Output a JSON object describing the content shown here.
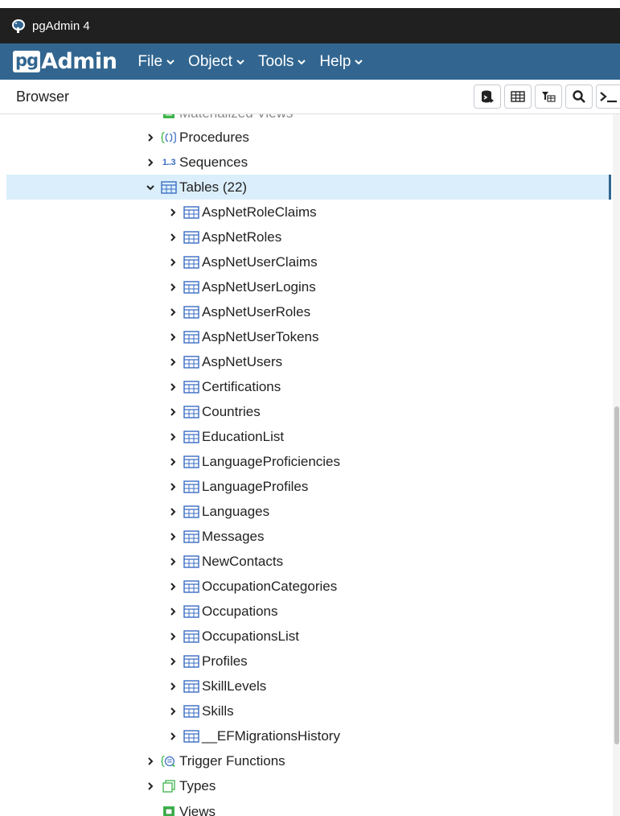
{
  "window": {
    "title": "pgAdmin 4"
  },
  "menubar": {
    "logo_pg": "pg",
    "logo_admin": "Admin",
    "menus": [
      "File",
      "Object",
      "Tools",
      "Help"
    ]
  },
  "browser": {
    "label": "Browser"
  },
  "toolbar": {
    "buttons": [
      "database-query-icon",
      "table-view-icon",
      "filtered-rows-icon",
      "search-icon",
      "psql-tool-icon"
    ]
  },
  "tree": {
    "cut_top_label": "Materialized Views",
    "procedures": "Procedures",
    "sequences": "Sequences",
    "sequences_icon": "1..3",
    "tables": "Tables (22)",
    "table_items": [
      "AspNetRoleClaims",
      "AspNetRoles",
      "AspNetUserClaims",
      "AspNetUserLogins",
      "AspNetUserRoles",
      "AspNetUserTokens",
      "AspNetUsers",
      "Certifications",
      "Countries",
      "EducationList",
      "LanguageProficiencies",
      "LanguageProfiles",
      "Languages",
      "Messages",
      "NewContacts",
      "OccupationCategories",
      "Occupations",
      "OccupationsList",
      "Profiles",
      "SkillLevels",
      "Skills",
      "__EFMigrationsHistory"
    ],
    "trigger_functions": "Trigger Functions",
    "types": "Types",
    "views": "Views"
  },
  "colors": {
    "titlebar": "#202020",
    "menubar": "#326690",
    "selected_row": "#dbeefb",
    "table_icon": "#3a6dc4",
    "green_icon": "#3cb44b"
  }
}
